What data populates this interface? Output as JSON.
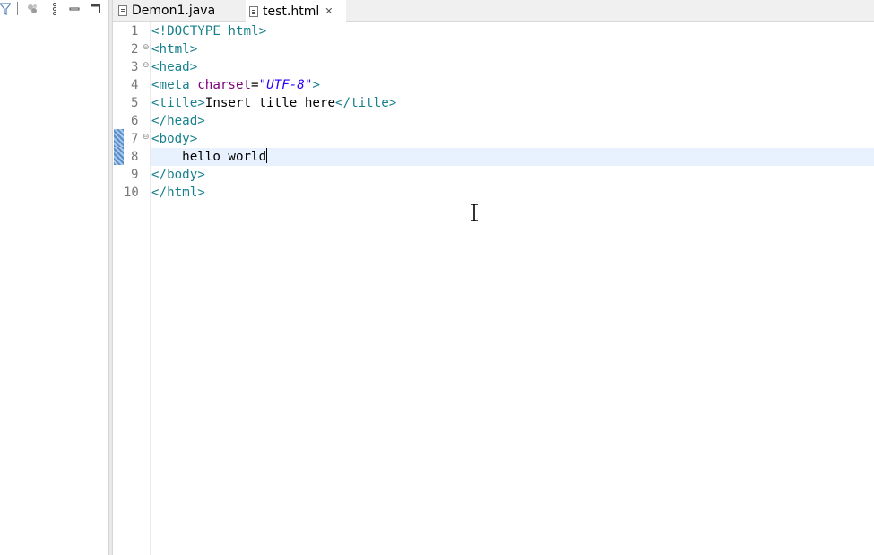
{
  "tabs": [
    {
      "label": "Demon1.java",
      "icon": "java-file-icon",
      "active": false
    },
    {
      "label": "test.html",
      "icon": "html-file-icon",
      "active": true,
      "close_glyph": "✕"
    }
  ],
  "toolbar": {
    "icons": [
      "filter-icon",
      "link-with-editor-icon",
      "view-menu-icon",
      "minimize-icon",
      "maximize-icon"
    ]
  },
  "editor": {
    "line_numbers": [
      "1",
      "2",
      "3",
      "4",
      "5",
      "6",
      "7",
      "8",
      "9",
      "10"
    ],
    "fold_markers": [
      "⊖",
      "⊖",
      "⊖"
    ],
    "current_line": 8,
    "lines": [
      {
        "t1": "<!DOCTYPE ",
        "t2": "html",
        "t3": ">"
      },
      {
        "t1": "<html>"
      },
      {
        "t1": "<head>"
      },
      {
        "t1": "<meta ",
        "attr": "charset",
        "eq": "=",
        "str": "\"UTF-8\"",
        "t3": ">"
      },
      {
        "t1": "<title>",
        "txt": "Insert title here",
        "t3": "</title>"
      },
      {
        "t1": "</head>"
      },
      {
        "t1": "<body>"
      },
      {
        "txt": "    hello world"
      },
      {
        "t1": "</body>"
      },
      {
        "t1": "</html>"
      }
    ]
  },
  "colors": {
    "tag": "#17808c",
    "attribute": "#7f007f",
    "string": "#2a00ff",
    "current_line_highlight": "#e8f2fe",
    "tab_bar": "#f0f0f0"
  }
}
